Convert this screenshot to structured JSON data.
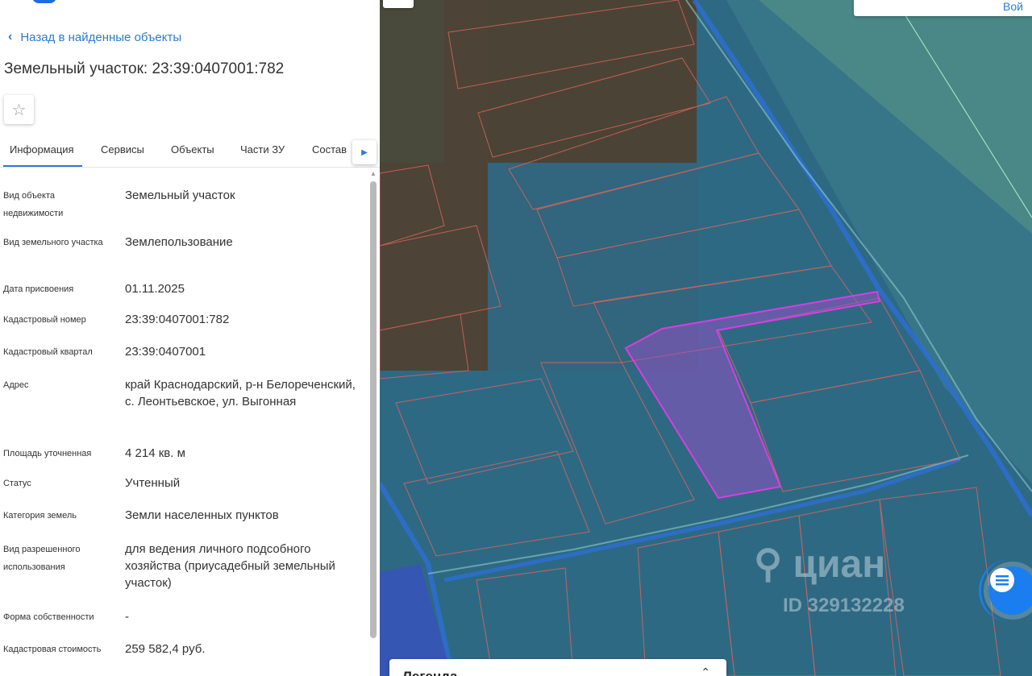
{
  "nav": {
    "back_label": "Назад в найденные объекты",
    "back_icon": "chevron-left-icon"
  },
  "object": {
    "title": "Земельный участок: 23:39:0407001:782",
    "favorite_icon": "star-icon"
  },
  "tabs": [
    {
      "label": "Информация",
      "active": true
    },
    {
      "label": "Сервисы",
      "active": false
    },
    {
      "label": "Объекты",
      "active": false
    },
    {
      "label": "Части ЗУ",
      "active": false
    },
    {
      "label": "Состав",
      "active": false
    }
  ],
  "info": [
    {
      "label": "Вид объекта недвижимости",
      "value": "Земельный участок"
    },
    {
      "label": "Вид земельного участка",
      "value": "Землепользование"
    },
    {
      "label": "Дата присвоения",
      "value": "01.11.2025"
    },
    {
      "label": "Кадастровый номер",
      "value": "23:39:0407001:782"
    },
    {
      "label": "Кадастровый квартал",
      "value": "23:39:0407001"
    },
    {
      "label": "Адрес",
      "value": "край Краснодарский, р-н Белореченский, с. Леонтьевское, ул. Выгонная"
    },
    {
      "label": "Площадь уточненная",
      "value": "4 214 кв. м"
    },
    {
      "label": "Статус",
      "value": "Учтенный"
    },
    {
      "label": "Категория земель",
      "value": "Земли населенных пунктов"
    },
    {
      "label": "Вид разрешенного использования",
      "value": "для ведения личного подсобного хозяйства (приусадебный земельный участок)"
    },
    {
      "label": "Форма собственности",
      "value": "-"
    },
    {
      "label": "Кадастровая стоимость",
      "value": "259 582,4 руб."
    }
  ],
  "map": {
    "login_label": "Вой",
    "legend_title": "Легенда",
    "legend_toggle_icon": "chevron-up-icon",
    "chat_icon": "chat-icon",
    "watermark_brand": "циан",
    "watermark_id": "ID 329132228",
    "colors": {
      "selected_parcel": "#c23bd4",
      "parcel_border": "#e0665a",
      "zone_overlay": "#2f7fa6",
      "accent": "#2b7cd3"
    }
  }
}
